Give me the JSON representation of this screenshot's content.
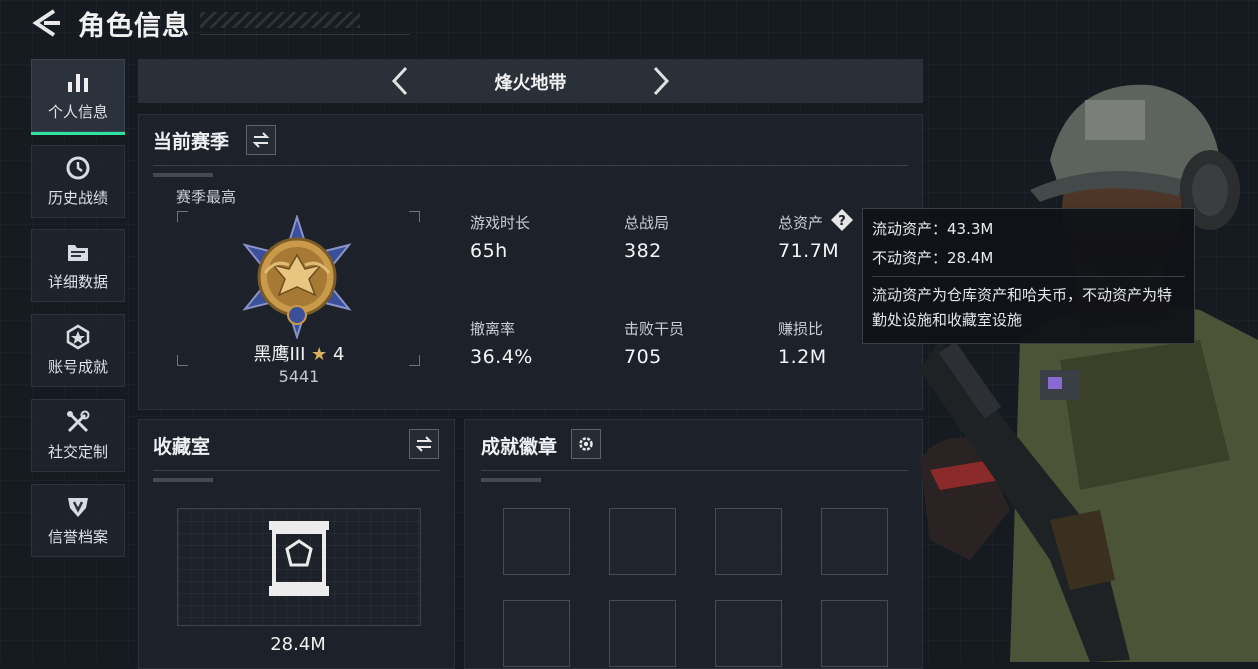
{
  "header": {
    "title": "角色信息"
  },
  "sidebar": {
    "items": [
      {
        "label": "个人信息",
        "icon": "bar-chart-icon",
        "active": true
      },
      {
        "label": "历史战绩",
        "icon": "clock-icon"
      },
      {
        "label": "详细数据",
        "icon": "folder-icon"
      },
      {
        "label": "账号成就",
        "icon": "achievement-star-icon"
      },
      {
        "label": "社交定制",
        "icon": "tools-icon"
      },
      {
        "label": "信誉档案",
        "icon": "shield-badge-icon"
      }
    ]
  },
  "mode_selector": {
    "name": "烽火地带"
  },
  "season": {
    "title": "当前赛季",
    "best_label": "赛季最高",
    "rank": {
      "name": "黑鹰III",
      "stars": "4",
      "score": "5441"
    },
    "stats": [
      {
        "label": "游戏时长",
        "value": "65h"
      },
      {
        "label": "总战局",
        "value": "382"
      },
      {
        "label": "总资产",
        "value": "71.7M"
      },
      {
        "label": "撤离率",
        "value": "36.4%"
      },
      {
        "label": "击败干员",
        "value": "705"
      },
      {
        "label": "赚损比",
        "value": "1.2M"
      }
    ]
  },
  "tooltip": {
    "liquid_assets": "流动资产：43.3M",
    "fixed_assets": "不动资产：28.4M",
    "description": "流动资产为仓库资产和哈夫币，不动资产为特勤处设施和收藏室设施"
  },
  "collection": {
    "title": "收藏室",
    "value": "28.4M"
  },
  "achievements": {
    "title": "成就徽章"
  },
  "colors": {
    "accent": "#2ee3a0",
    "rank_gold": "#c89a4a",
    "rank_blue": "#3b4f9a"
  }
}
